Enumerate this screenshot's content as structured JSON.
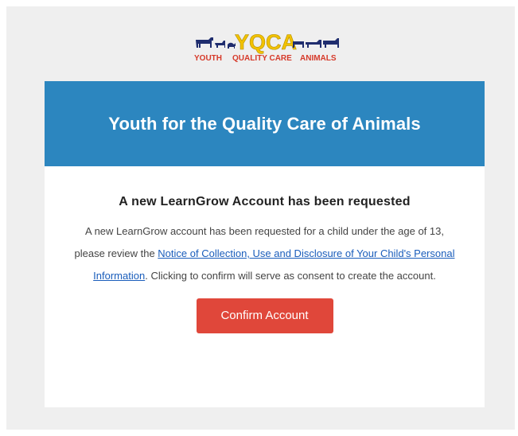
{
  "logo": {
    "wordmark": "YQCA",
    "tagline_youth": "YOUTH",
    "tagline_middle": "QUALITY CARE",
    "tagline_animals": "ANIMALS",
    "colors": {
      "wordmark": "#f2c200",
      "tagline": "#d63a2a",
      "animals": "#1f2d6e",
      "tagline_small": "#3a7d2c"
    }
  },
  "banner": {
    "title": "Youth for the Quality Care of Animals",
    "color": "#2c86bf"
  },
  "message": {
    "heading": "A new LearnGrow Account has been requested",
    "text_before": "A new LearnGrow account has been requested for a child under the age of 13, please review the ",
    "link_text": "Notice of Collection, Use and Disclosure of Your Child's Personal Information",
    "text_after": ". Clicking to confirm will serve as consent to create the account."
  },
  "confirm_button": {
    "label": "Confirm Account",
    "color": "#e0473a"
  }
}
